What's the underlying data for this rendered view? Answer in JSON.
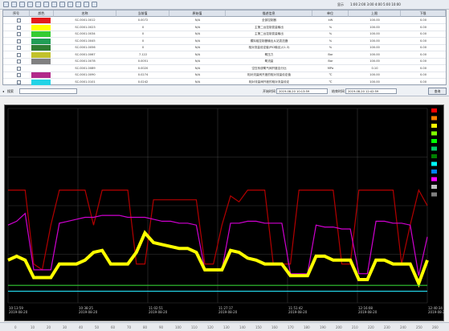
{
  "toolbar": {
    "icons": [
      "open-icon",
      "save-icon",
      "print-icon",
      "back-icon",
      "forward-icon",
      "zoom-in-icon",
      "zoom-out-icon",
      "fit-icon",
      "refresh-icon",
      "copy-icon",
      "export-icon",
      "settings-icon"
    ],
    "right_label": "显示",
    "right_values": "1:00 2:00 3:00 4:00 5:00 10:00"
  },
  "table": {
    "headers": [
      "序号",
      "颜色",
      "名称",
      "当前值",
      "原始值",
      "描述信息",
      "单位",
      "上限",
      "下限"
    ],
    "rows": [
      {
        "color": "#e31a1c",
        "name": "SC.0001.0012",
        "current": "0.0072",
        "raw": "N/A",
        "desc": "全部控制器",
        "unit": "kW",
        "upper": "100.00",
        "lower": "0.00"
      },
      {
        "color": "#ffff00",
        "name": "SC.0001.0023",
        "current": "0",
        "raw": "N/A",
        "desc": "主第二台控制变量输出",
        "unit": "%",
        "upper": "100.00",
        "lower": "0.00"
      },
      {
        "color": "#33cc33",
        "name": "SC.0001.0034",
        "current": "0",
        "raw": "N/A",
        "desc": "主第二台控制变量输出",
        "unit": "%",
        "upper": "100.00",
        "lower": "0.00"
      },
      {
        "color": "#1f9d55",
        "name": "SC.0001.0045",
        "current": "0",
        "raw": "N/A",
        "desc": "模拟组控制器输出从站变送器",
        "unit": "%",
        "upper": "100.00",
        "lower": "0.00"
      },
      {
        "color": "#2e7d32",
        "name": "SC.0001.0056",
        "current": "0",
        "raw": "N/A",
        "desc": "相对流量设定值(PID输出)/(1-3)",
        "unit": "%",
        "upper": "100.00",
        "lower": "0.00"
      },
      {
        "color": "#c2c22b",
        "name": "SC.0001.0067",
        "current": "7.122",
        "raw": "N/A",
        "desc": "氧压力",
        "unit": "Bar",
        "upper": "100.00",
        "lower": "0.00"
      },
      {
        "color": "#808080",
        "name": "SC.0001.0078",
        "current": "0.0051",
        "raw": "N/A",
        "desc": "氧流量",
        "unit": "Bar",
        "upper": "100.00",
        "lower": "0.00"
      },
      {
        "color": "#ffffff",
        "name": "SC.0001.0089",
        "current": "0.0020",
        "raw": "N/A",
        "desc": "空压系统氧气阀开度百分比",
        "unit": "MPa",
        "upper": "0.10",
        "lower": "0.00"
      },
      {
        "color": "#b2298a",
        "name": "SC.0001.0090",
        "current": "0.0274",
        "raw": "N/A",
        "desc": "相对流量阀开度的相对流量设定值",
        "unit": "℃",
        "upper": "100.00",
        "lower": "0.00"
      },
      {
        "color": "#22d3e6",
        "name": "SC.0001.0101",
        "current": "0.0242",
        "raw": "N/A",
        "desc": "相对流量阀开度的相对流量设定",
        "unit": "℃",
        "upper": "100.00",
        "lower": "0.00"
      }
    ]
  },
  "bar": {
    "search_label": "搜索",
    "search_value": "",
    "start_label": "开始时间",
    "start_value": "2019-08-20 10:13:59",
    "end_label": "结束时间",
    "end_value": "2019-08-20 12:42:59",
    "query_label": "查询"
  },
  "chart_data": {
    "type": "line",
    "title": "",
    "xlabel": "",
    "ylabel": "",
    "grid": true,
    "background": "#000000",
    "x_ticks": [
      "10:13:59\n2019-08-20",
      "10:38:25\n2019-08-20",
      "11:02:51\n2019-08-20",
      "11:27:17\n2019-08-20",
      "11:51:42\n2019-08-20",
      "12:16:08\n2019-08-20",
      "12:40:34\n2019-08-20"
    ],
    "ylim": [
      0,
      100
    ],
    "series": [
      {
        "color": "#b30000",
        "values": [
          58,
          58,
          58,
          20,
          17,
          40,
          58,
          58,
          58,
          58,
          40,
          58,
          58,
          58,
          58,
          20,
          20,
          53,
          53,
          53,
          53,
          53,
          53,
          20,
          20,
          40,
          55,
          52,
          58,
          58,
          58,
          20,
          20,
          20,
          58,
          58,
          58,
          58,
          58,
          20,
          20,
          58,
          58,
          58,
          58,
          58,
          20,
          40,
          58,
          50
        ]
      },
      {
        "color": "#d000d0",
        "values": [
          40,
          42,
          46,
          17,
          17,
          17,
          41,
          42,
          43,
          44,
          44,
          45,
          45,
          45,
          44,
          44,
          44,
          43,
          42,
          42,
          41,
          41,
          40,
          17,
          17,
          17,
          41,
          41,
          42,
          42,
          41,
          41,
          41,
          15,
          15,
          15,
          40,
          39,
          39,
          38,
          38,
          15,
          15,
          42,
          42,
          41,
          41,
          40,
          14,
          34
        ]
      },
      {
        "color": "#ffff00",
        "values": [
          22,
          24,
          22,
          13,
          13,
          13,
          20,
          20,
          20,
          22,
          26,
          27,
          20,
          20,
          20,
          26,
          36,
          31,
          30,
          29,
          28,
          28,
          26,
          17,
          17,
          17,
          27,
          26,
          23,
          22,
          20,
          20,
          20,
          14,
          14,
          14,
          24,
          24,
          22,
          22,
          22,
          12,
          12,
          22,
          22,
          20,
          20,
          20,
          10,
          22
        ]
      },
      {
        "color": "#33cc33",
        "values": [
          9,
          9,
          9,
          9,
          9,
          9,
          9,
          9,
          9,
          9,
          9,
          9,
          9,
          9,
          9,
          9,
          9,
          9,
          9,
          9,
          9,
          9,
          9,
          9,
          9,
          9,
          9,
          9,
          9,
          9,
          9,
          9,
          9,
          9,
          9,
          9,
          9,
          9,
          9,
          9,
          9,
          9,
          9,
          9,
          9,
          9,
          9,
          9,
          9,
          9
        ]
      },
      {
        "color": "#22d3e6",
        "values": [
          6,
          6,
          6,
          6,
          6,
          6,
          6,
          6,
          6,
          6,
          6,
          6,
          6,
          6,
          6,
          6,
          6,
          6,
          6,
          6,
          6,
          6,
          6,
          6,
          6,
          6,
          6,
          6,
          6,
          6,
          6,
          6,
          6,
          6,
          6,
          6,
          6,
          6,
          6,
          6,
          6,
          6,
          6,
          6,
          6,
          6,
          6,
          6,
          6,
          6
        ]
      }
    ],
    "legend": [
      "#ff0000",
      "#ff7f00",
      "#ffff00",
      "#7fff00",
      "#00ff00",
      "#00cc66",
      "#008000",
      "#00ffff",
      "#0080ff",
      "#ff00ff",
      "#c0c0c0",
      "#808080"
    ]
  },
  "scroll": {
    "labels": [
      "0",
      "10",
      "20",
      "30",
      "40",
      "50",
      "60",
      "70",
      "80",
      "90",
      "100",
      "110",
      "120",
      "130",
      "140",
      "150",
      "160",
      "170",
      "180",
      "190",
      "200",
      "210",
      "220",
      "230",
      "240",
      "250",
      "260"
    ]
  }
}
